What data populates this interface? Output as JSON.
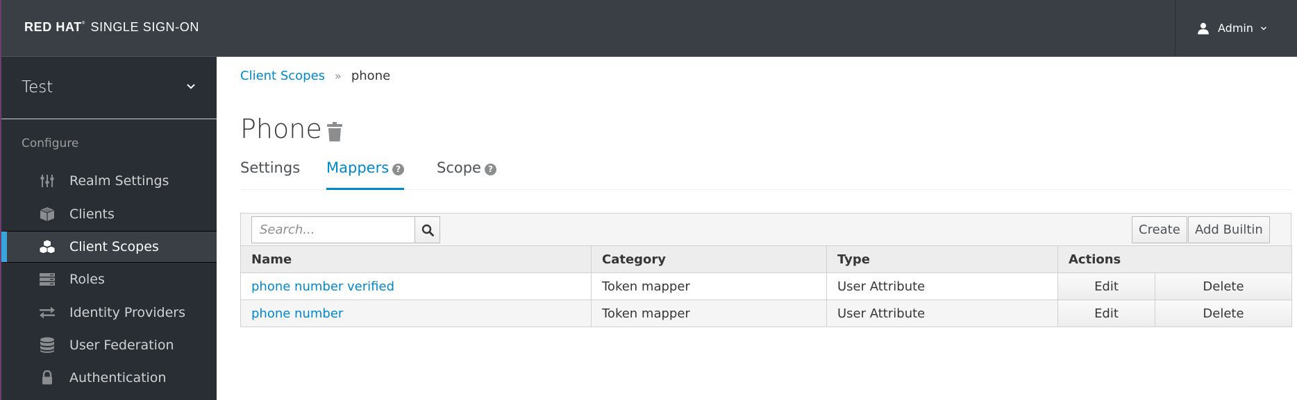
{
  "header": {
    "brand_bold": "RED HAT",
    "brand_reg": "®",
    "brand_rest": "SINGLE SIGN-ON",
    "user_label": "Admin",
    "user_icon": "user-icon",
    "caret_icon": "chevron-down-icon"
  },
  "sidebar": {
    "realm": "Test",
    "section": "Configure",
    "items": [
      {
        "label": "Realm Settings",
        "icon": "sliders-icon",
        "active": false
      },
      {
        "label": "Clients",
        "icon": "cube-icon",
        "active": false
      },
      {
        "label": "Client Scopes",
        "icon": "cubes-icon",
        "active": true
      },
      {
        "label": "Roles",
        "icon": "server-icon",
        "active": false
      },
      {
        "label": "Identity Providers",
        "icon": "exchange-icon",
        "active": false
      },
      {
        "label": "User Federation",
        "icon": "database-icon",
        "active": false
      },
      {
        "label": "Authentication",
        "icon": "lock-icon",
        "active": false
      }
    ]
  },
  "breadcrumb": {
    "parent": "Client Scopes",
    "separator": "»",
    "current": "phone"
  },
  "page": {
    "title": "Phone"
  },
  "tabs": [
    {
      "label": "Settings",
      "help": false,
      "active": false
    },
    {
      "label": "Mappers",
      "help": true,
      "active": true
    },
    {
      "label": "Scope",
      "help": true,
      "active": false
    }
  ],
  "toolbar": {
    "search_placeholder": "Search...",
    "search_value": "",
    "create_label": "Create",
    "add_builtin_label": "Add Builtin"
  },
  "table": {
    "columns": [
      "Name",
      "Category",
      "Type",
      "Actions"
    ],
    "rows": [
      {
        "name": "phone number verified",
        "category": "Token mapper",
        "type": "User Attribute",
        "edit": "Edit",
        "delete": "Delete"
      },
      {
        "name": "phone number",
        "category": "Token mapper",
        "type": "User Attribute",
        "edit": "Edit",
        "delete": "Delete"
      }
    ]
  },
  "colors": {
    "accent": "#0088ce",
    "active_nav_marker": "#39a5dc",
    "masthead_bg": "#393f44",
    "sidebar_bg": "#292e34"
  }
}
